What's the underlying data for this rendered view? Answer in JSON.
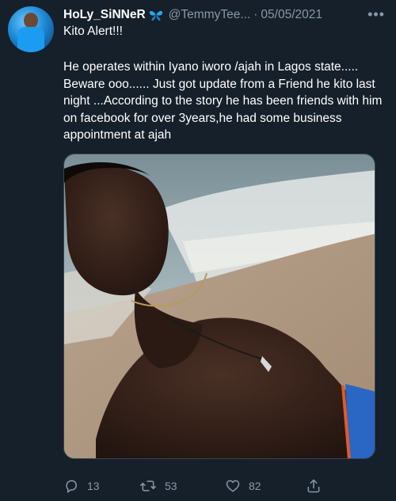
{
  "tweet": {
    "display_name": "HoLy_SiNNeR",
    "handle": "@TemmyTee...",
    "separator": "·",
    "date": "05/05/2021",
    "more": "•••",
    "first_line": "Kito Alert!!!",
    "body": "He operates within Iyano iworo /ajah in Lagos state..... Beware ooo...... Just got update from a Friend he kito last night ...According to the story he has been friends with him on facebook for over 3years,he had some business appointment at ajah"
  },
  "actions": {
    "reply_count": "13",
    "retweet_count": "53",
    "like_count": "82"
  },
  "icons": {
    "verified": "butterfly-emoji-icon",
    "more": "more-dots-icon",
    "reply": "reply-icon",
    "retweet": "retweet-icon",
    "like": "heart-icon",
    "share": "share-icon"
  },
  "colors": {
    "background": "#15202b",
    "secondary_text": "#8899a6",
    "primary_text": "#ffffff",
    "accent": "#1da1f2"
  }
}
